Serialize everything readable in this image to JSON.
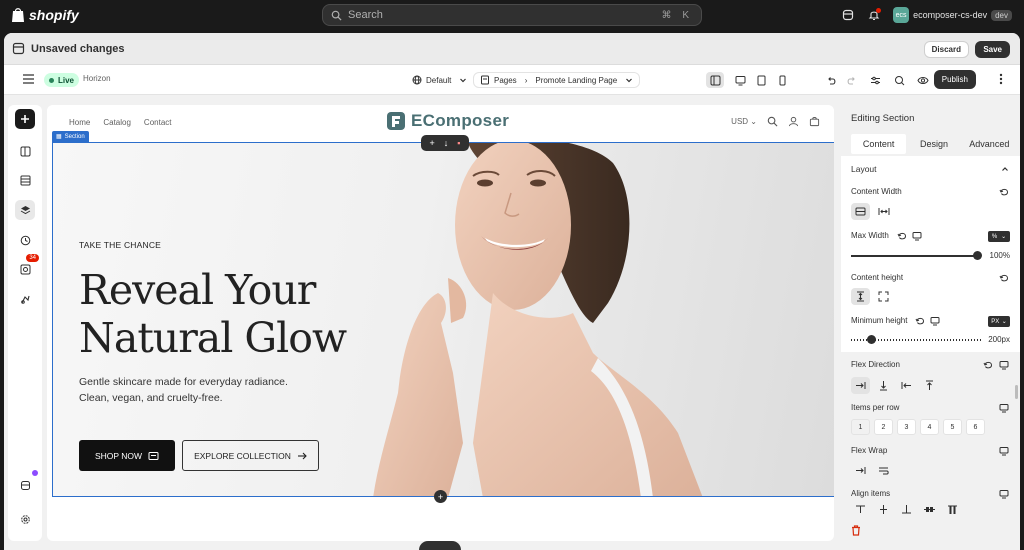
{
  "topbar": {
    "brand": "shopify",
    "search_placeholder": "Search",
    "search_shortcut": "⌘ K",
    "store_initials": "ecs",
    "store_name": "ecomposer-cs-dev",
    "store_tag": "dev"
  },
  "savebar": {
    "message": "Unsaved changes",
    "discard_label": "Discard",
    "save_label": "Save"
  },
  "editor_toolbar": {
    "status": "Live",
    "theme_name": "Horizon",
    "template_select": "Default",
    "pages_label": "Pages",
    "page_select": "Promote Landing Page",
    "publish_label": "Publish"
  },
  "left_rail": {
    "notification_count": "34"
  },
  "storefront": {
    "nav": [
      "Home",
      "Catalog",
      "Contact"
    ],
    "brand_name": "EComposer",
    "currency": "USD",
    "section_label": "Section"
  },
  "hero": {
    "eyebrow": "TAKE THE CHANCE",
    "headline_line1": "Reveal Your",
    "headline_line2": "Natural Glow",
    "subtext_line1": "Gentle skincare made for everyday radiance.",
    "subtext_line2": "Clean, vegan, and cruelty-free.",
    "primary_cta": "SHOP NOW",
    "secondary_cta": "EXPLORE COLLECTION"
  },
  "panel": {
    "title": "Editing Section",
    "tabs": [
      "Content",
      "Design",
      "Advanced"
    ],
    "active_tab": "Content",
    "group_title": "Layout",
    "content_width_label": "Content Width",
    "max_width_label": "Max Width",
    "max_width_unit": "%",
    "max_width_value": "100%",
    "max_width_fraction": 1.0,
    "content_height_label": "Content height",
    "min_height_label": "Minimum height",
    "min_height_unit": "PX",
    "min_height_value": "200px",
    "min_height_fraction": 0.16,
    "flex_direction_label": "Flex Direction",
    "items_per_row_label": "Items per row",
    "items_per_row_options": [
      "1",
      "2",
      "3",
      "4",
      "5",
      "6"
    ],
    "flex_wrap_label": "Flex Wrap",
    "align_items_label": "Align items"
  },
  "colors": {
    "accent_blue": "#2c6ecb",
    "dark": "#303030",
    "live_green": "#29845a",
    "badge_red": "#e51c00"
  }
}
